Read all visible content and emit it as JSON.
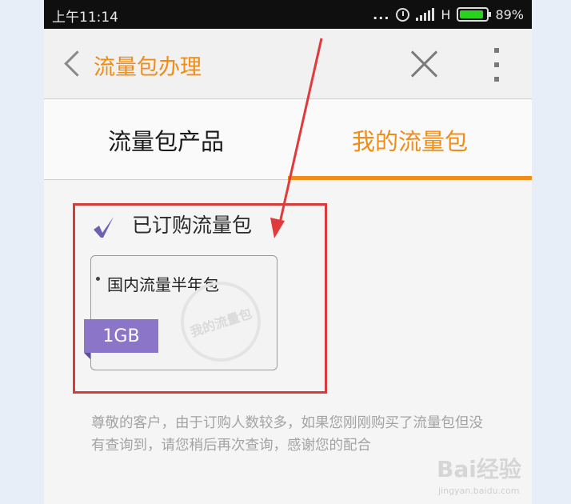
{
  "status_bar": {
    "time": "上午11:14",
    "dots": "...",
    "network": "H",
    "battery": "89%",
    "battery_level": 0.89
  },
  "header": {
    "title": "流量包办理"
  },
  "tabs": [
    {
      "label": "流量包产品"
    },
    {
      "label": "我的流量包"
    }
  ],
  "content": {
    "section_title": "已订购流量包",
    "card": {
      "name": "国内流量半年包",
      "size": "1GB",
      "stamp": "我的流量包"
    },
    "notice": "尊敬的客户，由于订购人数较多，如果您刚刚购买了流量包但没有查询到，请您稍后再次查询，感谢您的配合"
  },
  "watermark": {
    "logo": "Bai经验",
    "site": "jingyan.baidu.com"
  },
  "colors": {
    "accent": "#f08d17",
    "highlight": "#d93a3a",
    "badge": "#8b75c9"
  }
}
